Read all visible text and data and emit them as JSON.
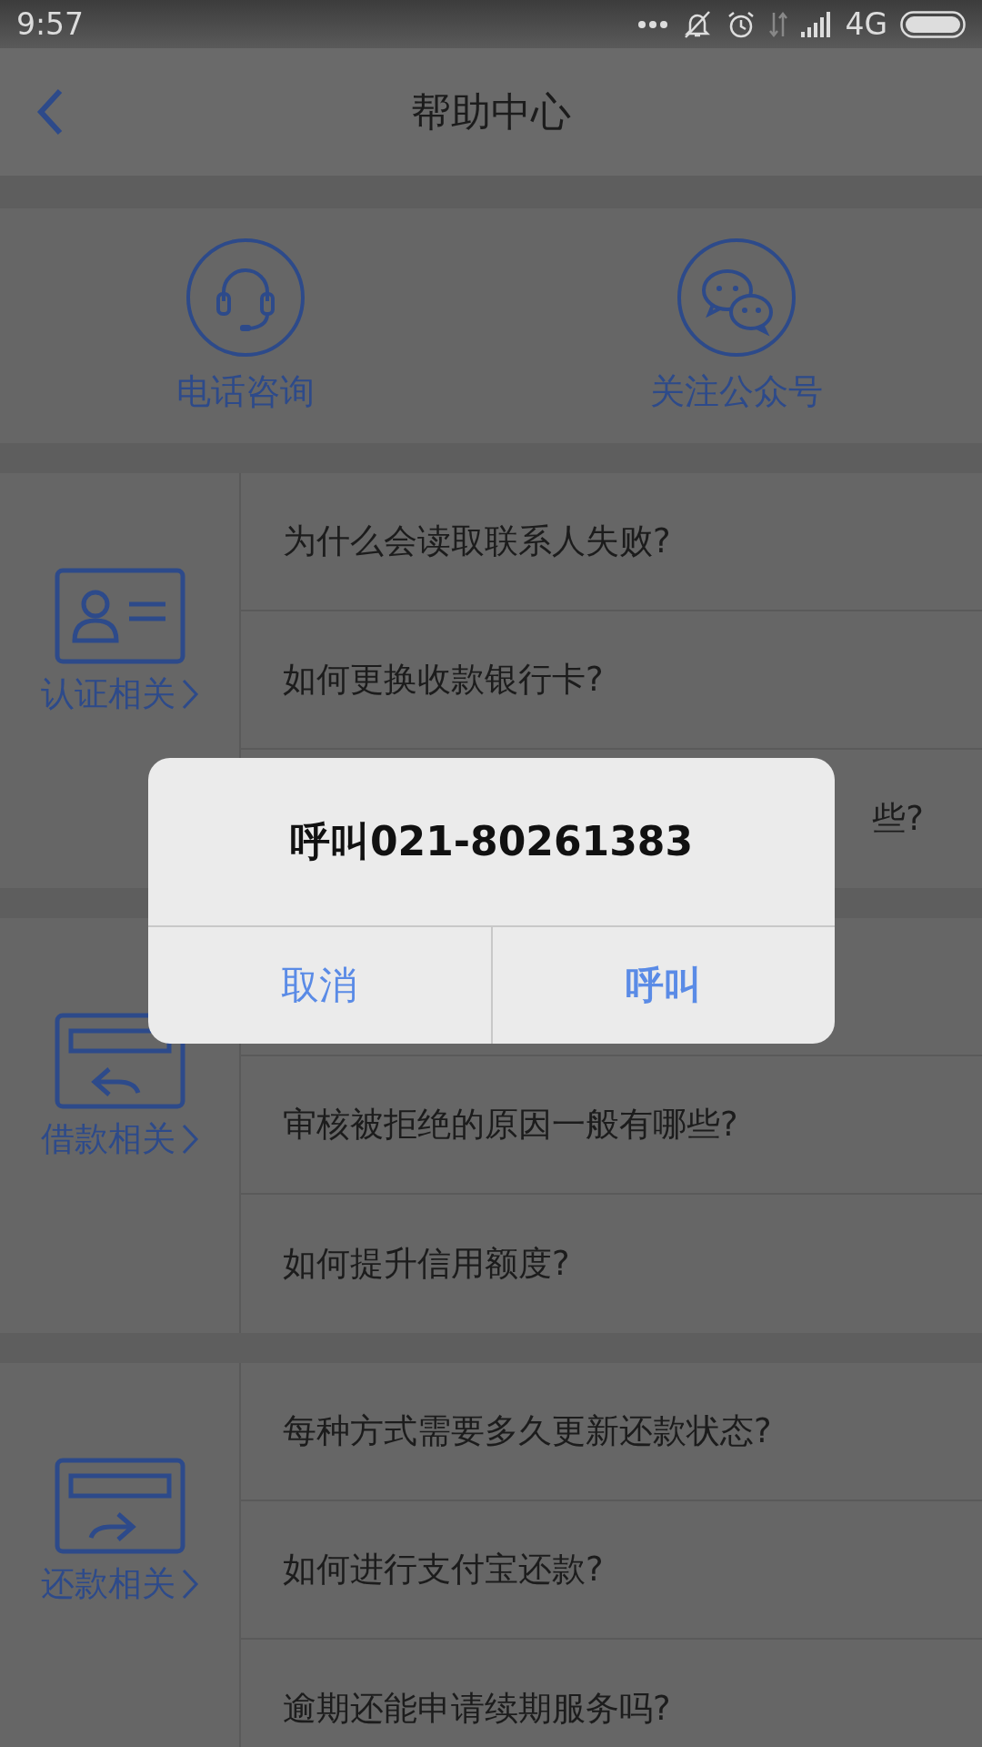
{
  "status_bar": {
    "time": "9:57",
    "network": "4G"
  },
  "header": {
    "title": "帮助中心"
  },
  "contacts": [
    {
      "label": "电话咨询",
      "kind": "phone"
    },
    {
      "label": "关注公众号",
      "kind": "wechat"
    }
  ],
  "sections": [
    {
      "label": "认证相关",
      "kind": "id-card",
      "rows": [
        {
          "kind": "full",
          "text": "为什么会读取联系人失败?"
        },
        {
          "kind": "full",
          "text": "如何更换收款银行卡?"
        },
        {
          "kind": "partial",
          "text": "些?"
        }
      ]
    },
    {
      "label": "借款相关",
      "kind": "borrow",
      "rows": [
        {
          "kind": "covered"
        },
        {
          "kind": "full",
          "text": "审核被拒绝的原因一般有哪些?"
        },
        {
          "kind": "full",
          "text": "如何提升信用额度?"
        }
      ]
    },
    {
      "label": "还款相关",
      "kind": "repay",
      "rows": [
        {
          "kind": "full",
          "text": "每种方式需要多久更新还款状态?"
        },
        {
          "kind": "full",
          "text": "如何进行支付宝还款?"
        },
        {
          "kind": "full",
          "text": "逾期还能申请续期服务吗?"
        }
      ]
    }
  ],
  "dialog": {
    "title": "呼叫021-80261383",
    "buttons": [
      {
        "label": "取消",
        "kind": "cancel"
      },
      {
        "label": "呼叫",
        "kind": "confirm"
      }
    ]
  }
}
